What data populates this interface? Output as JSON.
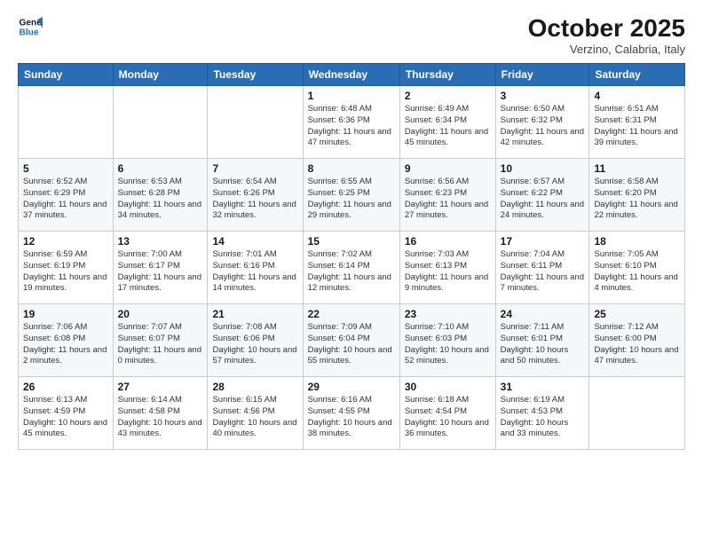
{
  "logo": {
    "line1": "General",
    "line2": "Blue"
  },
  "title": "October 2025",
  "subtitle": "Verzino, Calabria, Italy",
  "headers": [
    "Sunday",
    "Monday",
    "Tuesday",
    "Wednesday",
    "Thursday",
    "Friday",
    "Saturday"
  ],
  "rows": [
    [
      {
        "day": "",
        "info": ""
      },
      {
        "day": "",
        "info": ""
      },
      {
        "day": "",
        "info": ""
      },
      {
        "day": "1",
        "info": "Sunrise: 6:48 AM\nSunset: 6:36 PM\nDaylight: 11 hours\nand 47 minutes."
      },
      {
        "day": "2",
        "info": "Sunrise: 6:49 AM\nSunset: 6:34 PM\nDaylight: 11 hours\nand 45 minutes."
      },
      {
        "day": "3",
        "info": "Sunrise: 6:50 AM\nSunset: 6:32 PM\nDaylight: 11 hours\nand 42 minutes."
      },
      {
        "day": "4",
        "info": "Sunrise: 6:51 AM\nSunset: 6:31 PM\nDaylight: 11 hours\nand 39 minutes."
      }
    ],
    [
      {
        "day": "5",
        "info": "Sunrise: 6:52 AM\nSunset: 6:29 PM\nDaylight: 11 hours\nand 37 minutes."
      },
      {
        "day": "6",
        "info": "Sunrise: 6:53 AM\nSunset: 6:28 PM\nDaylight: 11 hours\nand 34 minutes."
      },
      {
        "day": "7",
        "info": "Sunrise: 6:54 AM\nSunset: 6:26 PM\nDaylight: 11 hours\nand 32 minutes."
      },
      {
        "day": "8",
        "info": "Sunrise: 6:55 AM\nSunset: 6:25 PM\nDaylight: 11 hours\nand 29 minutes."
      },
      {
        "day": "9",
        "info": "Sunrise: 6:56 AM\nSunset: 6:23 PM\nDaylight: 11 hours\nand 27 minutes."
      },
      {
        "day": "10",
        "info": "Sunrise: 6:57 AM\nSunset: 6:22 PM\nDaylight: 11 hours\nand 24 minutes."
      },
      {
        "day": "11",
        "info": "Sunrise: 6:58 AM\nSunset: 6:20 PM\nDaylight: 11 hours\nand 22 minutes."
      }
    ],
    [
      {
        "day": "12",
        "info": "Sunrise: 6:59 AM\nSunset: 6:19 PM\nDaylight: 11 hours\nand 19 minutes."
      },
      {
        "day": "13",
        "info": "Sunrise: 7:00 AM\nSunset: 6:17 PM\nDaylight: 11 hours\nand 17 minutes."
      },
      {
        "day": "14",
        "info": "Sunrise: 7:01 AM\nSunset: 6:16 PM\nDaylight: 11 hours\nand 14 minutes."
      },
      {
        "day": "15",
        "info": "Sunrise: 7:02 AM\nSunset: 6:14 PM\nDaylight: 11 hours\nand 12 minutes."
      },
      {
        "day": "16",
        "info": "Sunrise: 7:03 AM\nSunset: 6:13 PM\nDaylight: 11 hours\nand 9 minutes."
      },
      {
        "day": "17",
        "info": "Sunrise: 7:04 AM\nSunset: 6:11 PM\nDaylight: 11 hours\nand 7 minutes."
      },
      {
        "day": "18",
        "info": "Sunrise: 7:05 AM\nSunset: 6:10 PM\nDaylight: 11 hours\nand 4 minutes."
      }
    ],
    [
      {
        "day": "19",
        "info": "Sunrise: 7:06 AM\nSunset: 6:08 PM\nDaylight: 11 hours\nand 2 minutes."
      },
      {
        "day": "20",
        "info": "Sunrise: 7:07 AM\nSunset: 6:07 PM\nDaylight: 11 hours\nand 0 minutes."
      },
      {
        "day": "21",
        "info": "Sunrise: 7:08 AM\nSunset: 6:06 PM\nDaylight: 10 hours\nand 57 minutes."
      },
      {
        "day": "22",
        "info": "Sunrise: 7:09 AM\nSunset: 6:04 PM\nDaylight: 10 hours\nand 55 minutes."
      },
      {
        "day": "23",
        "info": "Sunrise: 7:10 AM\nSunset: 6:03 PM\nDaylight: 10 hours\nand 52 minutes."
      },
      {
        "day": "24",
        "info": "Sunrise: 7:11 AM\nSunset: 6:01 PM\nDaylight: 10 hours\nand 50 minutes."
      },
      {
        "day": "25",
        "info": "Sunrise: 7:12 AM\nSunset: 6:00 PM\nDaylight: 10 hours\nand 47 minutes."
      }
    ],
    [
      {
        "day": "26",
        "info": "Sunrise: 6:13 AM\nSunset: 4:59 PM\nDaylight: 10 hours\nand 45 minutes."
      },
      {
        "day": "27",
        "info": "Sunrise: 6:14 AM\nSunset: 4:58 PM\nDaylight: 10 hours\nand 43 minutes."
      },
      {
        "day": "28",
        "info": "Sunrise: 6:15 AM\nSunset: 4:56 PM\nDaylight: 10 hours\nand 40 minutes."
      },
      {
        "day": "29",
        "info": "Sunrise: 6:16 AM\nSunset: 4:55 PM\nDaylight: 10 hours\nand 38 minutes."
      },
      {
        "day": "30",
        "info": "Sunrise: 6:18 AM\nSunset: 4:54 PM\nDaylight: 10 hours\nand 36 minutes."
      },
      {
        "day": "31",
        "info": "Sunrise: 6:19 AM\nSunset: 4:53 PM\nDaylight: 10 hours\nand 33 minutes."
      },
      {
        "day": "",
        "info": ""
      }
    ]
  ]
}
